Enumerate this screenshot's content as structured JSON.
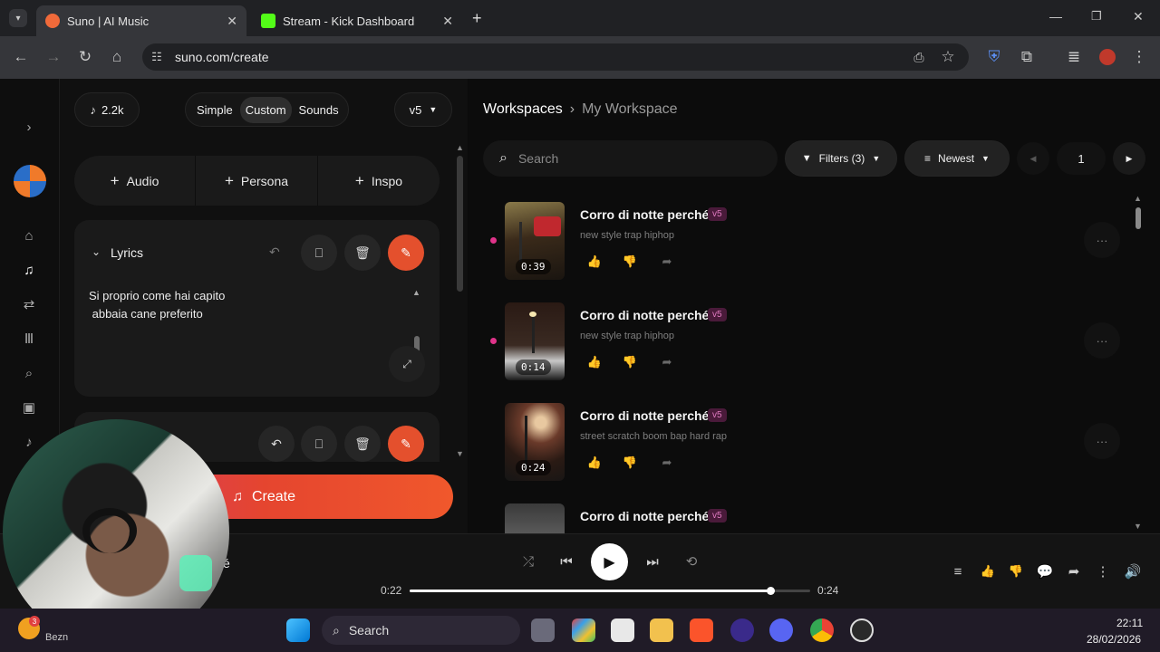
{
  "browser": {
    "tabs": [
      {
        "title": "Suno | AI Music",
        "favicon_color": "#f06a3a"
      },
      {
        "title": "Stream - Kick Dashboard",
        "favicon_color": "#53fc18"
      }
    ],
    "url": "suno.com/create"
  },
  "left_panel": {
    "credits": "2.2k",
    "modes": [
      "Simple",
      "Custom",
      "Sounds"
    ],
    "active_mode": "Custom",
    "model": "v5",
    "add_buttons": [
      "Audio",
      "Persona",
      "Inspo"
    ],
    "lyrics_label": "Lyrics",
    "lyrics_text": "Si proprio come hai capito\n abbaia cane preferito",
    "create_label": "Create"
  },
  "right_panel": {
    "breadcrumb_root": "Workspaces",
    "breadcrumb_current": "My Workspace",
    "search_placeholder": "Search",
    "filters_label": "Filters (3)",
    "sort_label": "Newest",
    "page_number": "1",
    "songs": [
      {
        "title": "Corro di notte perché",
        "badge": "v5",
        "style": "new style trap hiphop",
        "duration": "0:39"
      },
      {
        "title": "Corro di notte perché",
        "badge": "v5",
        "style": "new style trap hiphop",
        "duration": "0:14"
      },
      {
        "title": "Corro di notte perché",
        "badge": "v5",
        "style": "street scratch boom bap hard rap",
        "duration": "0:24"
      },
      {
        "title": "Corro di notte perché",
        "badge": "v5",
        "style": "",
        "duration": ""
      }
    ]
  },
  "player": {
    "elapsed": "0:22",
    "total": "0:24",
    "progress": 0.9,
    "track_letter": "é"
  },
  "taskbar": {
    "search_label": "Search",
    "time": "22:11",
    "date": "28/02/2026",
    "weather_badge": "3",
    "weather_text": "Bezn"
  },
  "colors": {
    "accent_orange": "#e4502d",
    "badge_pink": "#e07ac0",
    "dot_pink": "#e0338a"
  }
}
